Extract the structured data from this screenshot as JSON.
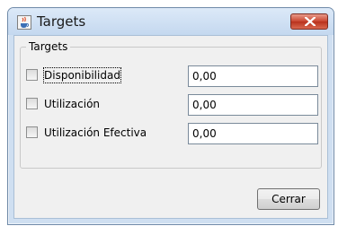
{
  "window": {
    "title": "Targets",
    "icon": "java-cup-icon",
    "close_icon": "close-icon",
    "close_color": "#c9442e"
  },
  "group": {
    "legend": "Targets"
  },
  "rows": [
    {
      "label": "Disponibilidad",
      "checked": false,
      "value": "0,00"
    },
    {
      "label": "Utilización",
      "checked": false,
      "value": "0,00"
    },
    {
      "label": "Utilización Efectiva",
      "checked": false,
      "value": "0,00"
    }
  ],
  "buttons": {
    "close_label": "Cerrar"
  }
}
